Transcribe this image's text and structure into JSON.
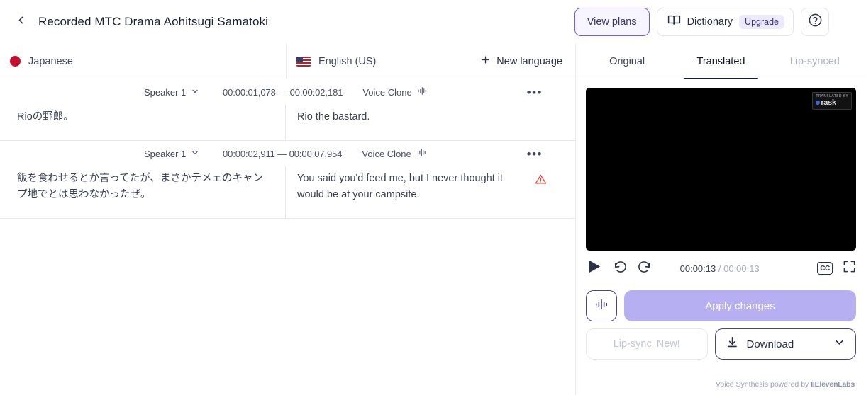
{
  "header": {
    "back_icon": "chevron-left-icon",
    "title": "Recorded MTC Drama Aohitsugi Samatoki",
    "view_plans_label": "View plans",
    "dictionary_icon": "book-icon",
    "dictionary_label": "Dictionary",
    "upgrade_badge": "Upgrade",
    "help_icon": "help-circle-icon"
  },
  "colors": {
    "accent_purple": "#6f5ce6",
    "apply_button": "#b6b0f2",
    "badge_bg": "#eceafc",
    "speaker_dot": "#4b8df8",
    "warning_red": "#e8453c",
    "tab_active_underline": "#181c2a",
    "deco_purple_dark": "#5b45c0",
    "deco_purple_mid": "#8677d6",
    "deco_purple_light": "#cdc8ec",
    "deco_purple_pale": "#e0dcf1"
  },
  "language_bar": {
    "source": {
      "flag": "flag-japan-icon",
      "name": "Japanese"
    },
    "target": {
      "flag": "flag-us-icon",
      "name": "English (US)"
    },
    "new_language_label": "New language",
    "new_language_icon": "plus-icon"
  },
  "segments": [
    {
      "speaker": "Speaker 1",
      "time_start": "00:00:01,078",
      "time_separator": "—",
      "time_end": "00:00:02,181",
      "time_range": "00:00:01,078 — 00:00:02,181",
      "voice_label": "Voice Clone",
      "voice_icon": "waveform-icon",
      "more_icon": "ellipsis-icon",
      "more_glyph": "•••",
      "source_text": "Rioの野郎。",
      "target_text": "Rio the bastard.",
      "has_warning": false
    },
    {
      "speaker": "Speaker 1",
      "time_start": "00:00:02,911",
      "time_separator": "—",
      "time_end": "00:00:07,954",
      "time_range": "00:00:02,911 — 00:00:07,954",
      "voice_label": "Voice Clone",
      "voice_icon": "waveform-icon",
      "more_icon": "ellipsis-icon",
      "more_glyph": "•••",
      "source_text": "飯を食わせるとか言ってたが、まさかテメェのキャンプ地でとは思わなかったぜ。",
      "target_text": "You said you'd feed me, but I never thought it would be at your campsite.",
      "has_warning": true,
      "warning_icon": "warning-triangle-icon"
    }
  ],
  "right_panel": {
    "tabs": [
      {
        "label": "Original",
        "state": "inactive"
      },
      {
        "label": "Translated",
        "state": "active"
      },
      {
        "label": "Lip-synced",
        "state": "disabled"
      }
    ],
    "video": {
      "watermark_top": "TRANSLATED BY",
      "watermark_main": "rask"
    },
    "player": {
      "play_icon": "play-icon",
      "rewind_icon": "rewind-icon",
      "forward_icon": "forward-icon",
      "current_time": "00:00:13",
      "time_divider": "/",
      "total_time": "00:00:13",
      "cc_label": "CC",
      "cc_icon": "closed-captions-icon",
      "fullscreen_icon": "fullscreen-icon"
    },
    "actions": {
      "waveform_icon": "waveform-icon",
      "apply_label": "Apply changes",
      "lipsync_label": "Lip-sync",
      "lipsync_new_label": "New!",
      "download_label": "Download",
      "download_icon": "download-icon",
      "download_caret_icon": "chevron-down-icon"
    },
    "footer": {
      "powered_prefix": "Voice Synthesis powered by",
      "powered_brand": "IIElevenLabs"
    }
  }
}
